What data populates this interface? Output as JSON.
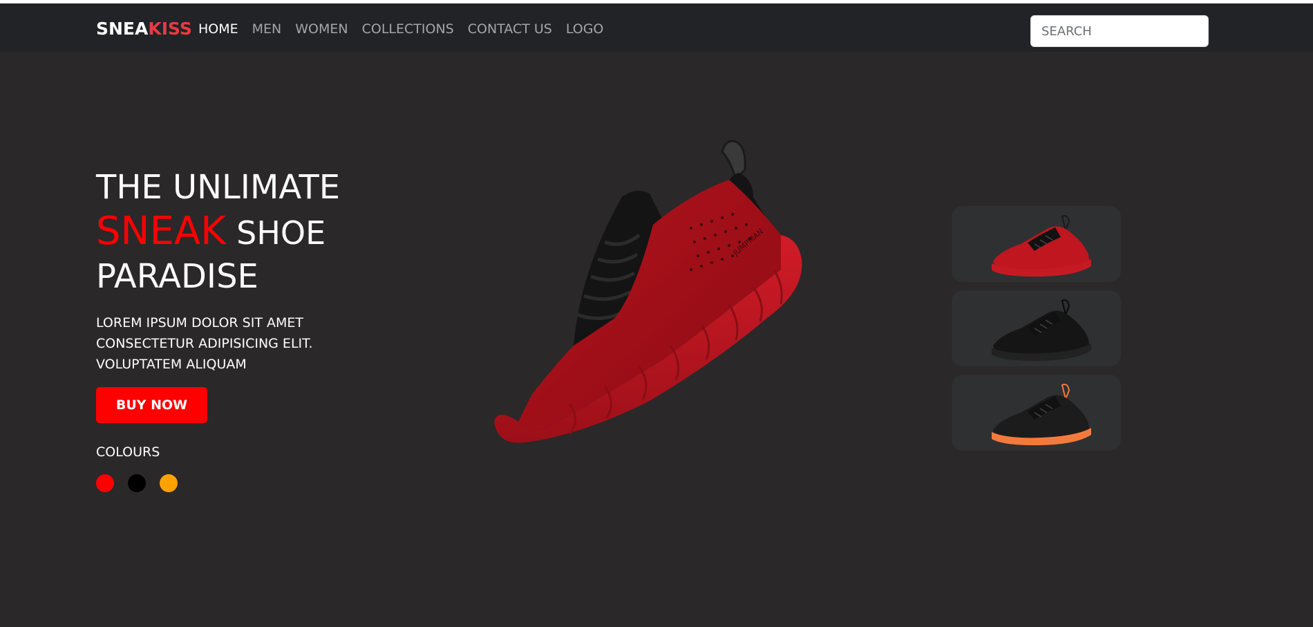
{
  "brand": {
    "part1": "SNEA",
    "part2": "KISS"
  },
  "nav": {
    "items": [
      {
        "label": "HOME",
        "active": true
      },
      {
        "label": "MEN",
        "active": false
      },
      {
        "label": "WOMEN",
        "active": false
      },
      {
        "label": "COLLECTIONS",
        "active": false
      },
      {
        "label": "CONTACT US",
        "active": false
      },
      {
        "label": "LOGO",
        "active": false
      }
    ]
  },
  "search": {
    "placeholder": "SEARCH",
    "value": ""
  },
  "hero": {
    "title_line1": "THE UNLIMATE",
    "title_accent": "SNEAK",
    "title_line2_rest": "SHOE",
    "title_line3": "PARADISE",
    "desc_line1": "LOREM IPSUM DOLOR SIT AMET",
    "desc_line2": "CONSECTETUR ADIPISICING ELIT.",
    "desc_line3": "VOLUPTATEM ALIQUAM",
    "buy_label": "BUY NOW",
    "colours_label": "COLOURS",
    "shoe_brand_text": "JUMPMAN"
  },
  "colours": [
    {
      "name": "red",
      "hex": "#ff0000"
    },
    {
      "name": "black",
      "hex": "#000000"
    },
    {
      "name": "orange",
      "hex": "#ffa200"
    }
  ],
  "thumbnails": [
    {
      "name": "red-shoe",
      "upper": "#c01620",
      "sole": "#c51a24",
      "trim": "#1a1a1a"
    },
    {
      "name": "black-shoe",
      "upper": "#151515",
      "sole": "#222222",
      "trim": "#0a0a0a"
    },
    {
      "name": "orange-shoe",
      "upper": "#1c1c1c",
      "sole": "#f47a3c",
      "trim": "#f47a3c"
    }
  ],
  "theme": {
    "accent": "#ff0000",
    "brand_accent": "#e83a42",
    "background": "#2a2829",
    "navbar": "#212326"
  }
}
